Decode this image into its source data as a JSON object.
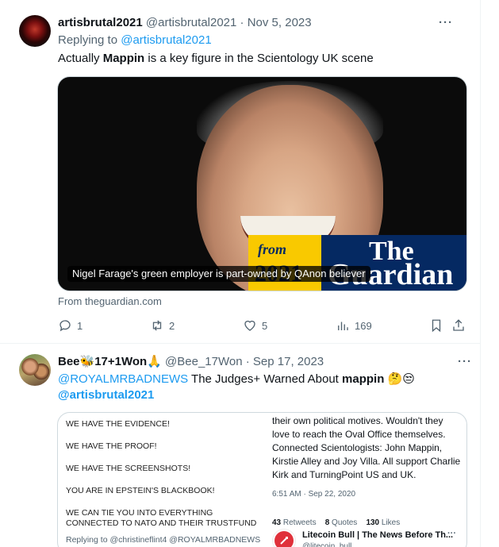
{
  "tweet1": {
    "display_name": "artisbrutal2021",
    "handle": "@artisbrutal2021",
    "separator": "·",
    "date": "Nov 5, 2023",
    "replying_prefix": "Replying to ",
    "replying_to": "@artisbrutal2021",
    "text_before": "Actually ",
    "text_bold": "Mappin",
    "text_after": " is a key figure in the Scientology UK scene",
    "card": {
      "caption": "Nigel Farage's green employer is part-owned by QAnon believer",
      "badge_from": "from",
      "badge_year": "2021",
      "badge_the": "The",
      "badge_guardian": "Guardian",
      "domain": "From theguardian.com"
    },
    "actions": {
      "replies": "1",
      "reposts": "2",
      "likes": "5",
      "views": "169"
    }
  },
  "tweet2": {
    "display_name": "Bee🐝17+1Won🙏",
    "handle": "@Bee_17Won",
    "separator": "·",
    "date": "Sep 17, 2023",
    "mention1": "@ROYALMRBADNEWS",
    "text_mid": " The Judges+ Warned About ",
    "text_bold": "mappin",
    "emojis": " 🤔😒",
    "mention2": "@artisbrutal2021",
    "image": {
      "left_lines": [
        "WE HAVE THE EVIDENCE!",
        "WE HAVE THE PROOF!",
        "WE HAVE THE SCREENSHOTS!",
        "YOU ARE IN EPSTEIN'S BLACKBOOK!",
        "WE CAN TIE YOU INTO EVERYTHING",
        "CONNECTED TO NATO AND THEIR TRUSTFUND"
      ],
      "left_reply": "Replying to @christineflint4 @ROYALMRBADNEWS",
      "right_text": "their own political motives. Wouldn't they love to reach the Oval Office themselves. Connected Scientologists: John Mappin, Kirstie Alley and Joy Villa. All support Charlie Kirk and TurningPoint US and UK.",
      "right_time": "6:51 AM · Sep 22, 2020",
      "stats_retweets_num": "43",
      "stats_retweets_label": " Retweets",
      "stats_quotes_num": "8",
      "stats_quotes_label": " Quotes",
      "stats_likes_num": "130",
      "stats_likes_label": " Likes",
      "quote_name": "Litecoin Bull | The News Before Th...",
      "quote_handle": "@litecoin_bull",
      "quote_more": "···"
    }
  },
  "more_icon": "···",
  "colors": {
    "link": "#1d9bf0",
    "muted": "#536471",
    "text": "#0f1419"
  }
}
